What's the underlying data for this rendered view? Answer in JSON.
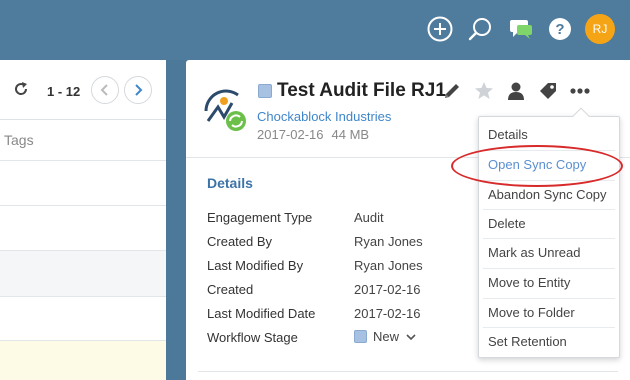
{
  "toolbar": {
    "avatar_initials": "RJ"
  },
  "list": {
    "pager": "1 - 12",
    "column_tags": "Tags"
  },
  "file": {
    "title": "Test Audit File RJ1",
    "entity": "Chockablock Industries",
    "date": "2017-02-16",
    "size": "44 MB"
  },
  "details": {
    "heading": "Details",
    "rows": [
      {
        "label": "Engagement Type",
        "value": "Audit"
      },
      {
        "label": "Created By",
        "value": "Ryan Jones"
      },
      {
        "label": "Last Modified By",
        "value": "Ryan Jones"
      },
      {
        "label": "Created",
        "value": "2017-02-16"
      },
      {
        "label": "Last Modified Date",
        "value": "2017-02-16"
      },
      {
        "label": "Workflow Stage",
        "value": "New"
      }
    ]
  },
  "menu": {
    "items": [
      "Details",
      "Open Sync Copy",
      "Abandon Sync Copy",
      "Delete",
      "Mark as Unread",
      "Move to Entity",
      "Move to Folder",
      "Set Retention"
    ],
    "highlighted_index": 1
  },
  "colors": {
    "topbar": "#4f7b9c",
    "link": "#3f86c9",
    "avatar": "#f5a416",
    "annotation": "#d82a2a"
  }
}
